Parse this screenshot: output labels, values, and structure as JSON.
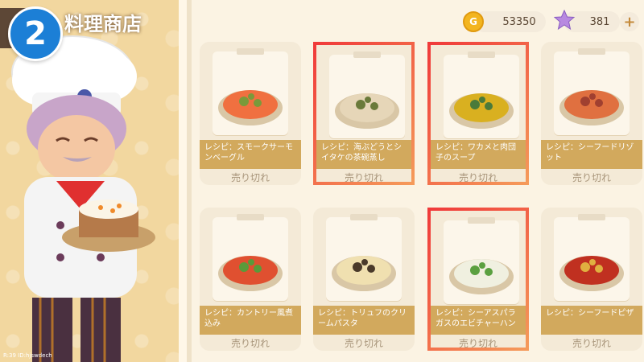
{
  "badge": {
    "number": "2"
  },
  "shop": {
    "title": "料理商店"
  },
  "watermark": "R:39  ID:hjswdech",
  "currency": {
    "coins": "53350",
    "stars": "381",
    "coin_icon": "coin-icon",
    "star_icon": "star-icon",
    "plus_icon": "plus-icon"
  },
  "colors": {
    "accent": "#d2a95d",
    "selected_border": "#f03a3a",
    "badge": "#1c7fd6"
  },
  "cards": [
    {
      "label": "レシピ：スモークサーモンベーグル",
      "status": "売り切れ",
      "selected": false
    },
    {
      "label": "レシピ：海ぶどうとシイタケの茶碗蒸し",
      "status": "売り切れ",
      "selected": true
    },
    {
      "label": "レシピ：ワカメと肉団子のスープ",
      "status": "売り切れ",
      "selected": true
    },
    {
      "label": "レシピ：シーフードリゾット",
      "status": "売り切れ",
      "selected": false
    },
    {
      "label": "レシピ：カントリー風煮込み",
      "status": "売り切れ",
      "selected": false
    },
    {
      "label": "レシピ：トリュフのクリームパスタ",
      "status": "売り切れ",
      "selected": false
    },
    {
      "label": "レシピ：シーアスパラガスのエビチャーハン",
      "status": "売り切れ",
      "selected": true
    },
    {
      "label": "レシピ：シーフードピザ",
      "status": "売り切れ",
      "selected": false
    }
  ]
}
